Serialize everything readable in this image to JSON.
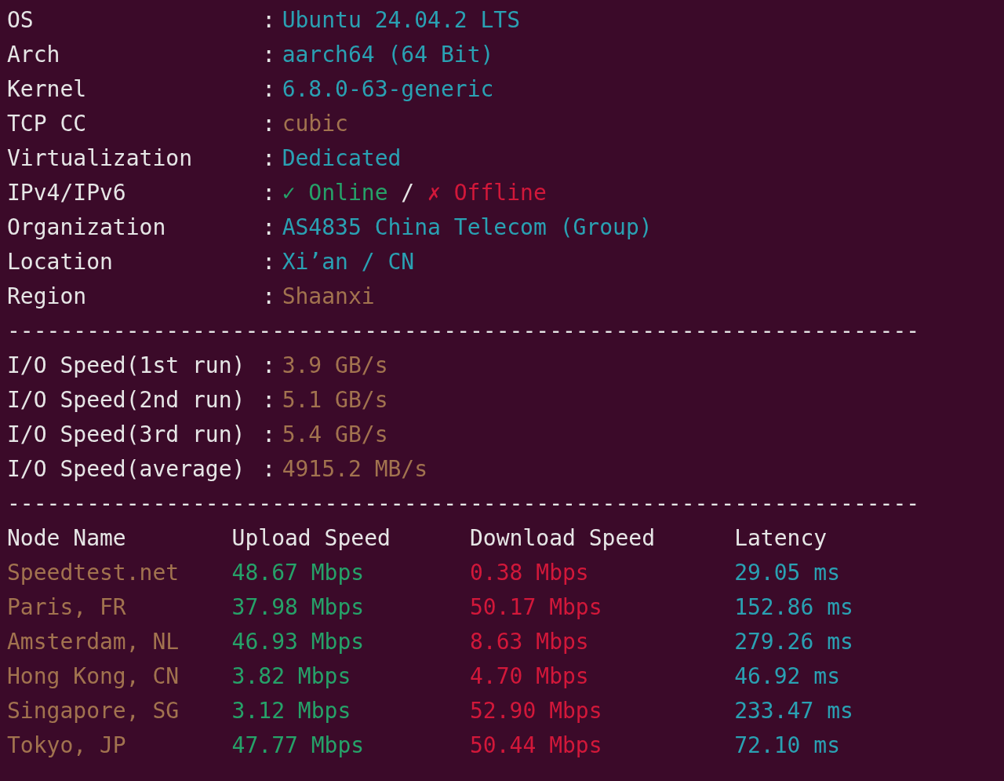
{
  "colon": ":",
  "system_info": [
    {
      "label": "OS",
      "values": [
        {
          "text": "Ubuntu 24.04.2 LTS",
          "color": "#2aa1b3"
        }
      ]
    },
    {
      "label": "Arch",
      "values": [
        {
          "text": "aarch64 (64 Bit)",
          "color": "#2aa1b3"
        }
      ]
    },
    {
      "label": "Kernel",
      "values": [
        {
          "text": "6.8.0-63-generic",
          "color": "#2aa1b3"
        }
      ]
    },
    {
      "label": "TCP CC",
      "values": [
        {
          "text": "cubic",
          "color": "#a2734f"
        }
      ]
    },
    {
      "label": "Virtualization",
      "values": [
        {
          "text": "Dedicated",
          "color": "#2aa1b3"
        }
      ]
    },
    {
      "label": "IPv4/IPv6",
      "values": [
        {
          "text": "✓ Online",
          "color": "#26a269"
        },
        {
          "text": "/",
          "color": "#e6e6e6"
        },
        {
          "text": "✗ Offline",
          "color": "#d2183a"
        }
      ]
    },
    {
      "label": "Organization",
      "values": [
        {
          "text": "AS4835 China Telecom (Group)",
          "color": "#2aa1b3"
        }
      ]
    },
    {
      "label": "Location",
      "values": [
        {
          "text": "Xi’an / CN",
          "color": "#2aa1b3"
        }
      ]
    },
    {
      "label": "Region",
      "values": [
        {
          "text": "Shaanxi",
          "color": "#a2734f"
        }
      ]
    }
  ],
  "separator_1": "---------------------------------------------------------------------",
  "io_speed": [
    {
      "label": "I/O Speed(1st run)",
      "value": "3.9 GB/s"
    },
    {
      "label": "I/O Speed(2nd run)",
      "value": "5.1 GB/s"
    },
    {
      "label": "I/O Speed(3rd run)",
      "value": "5.4 GB/s"
    },
    {
      "label": "I/O Speed(average)",
      "value": "4915.2 MB/s"
    }
  ],
  "separator_2": "---------------------------------------------------------------------",
  "speed_table": {
    "columns": [
      "Node Name",
      "Upload Speed",
      "Download Speed",
      "Latency"
    ],
    "rows": [
      [
        "Speedtest.net",
        "48.67 Mbps",
        "0.38 Mbps",
        "29.05 ms"
      ],
      [
        "Paris, FR",
        "37.98 Mbps",
        "50.17 Mbps",
        "152.86 ms"
      ],
      [
        "Amsterdam, NL",
        "46.93 Mbps",
        "8.63 Mbps",
        "279.26 ms"
      ],
      [
        "Hong Kong, CN",
        "3.82 Mbps",
        "4.70 Mbps",
        "46.92 ms"
      ],
      [
        "Singapore, SG",
        "3.12 Mbps",
        "52.90 Mbps",
        "233.47 ms"
      ],
      [
        "Tokyo, JP",
        "47.77 Mbps",
        "50.44 Mbps",
        "72.10 ms"
      ]
    ]
  }
}
